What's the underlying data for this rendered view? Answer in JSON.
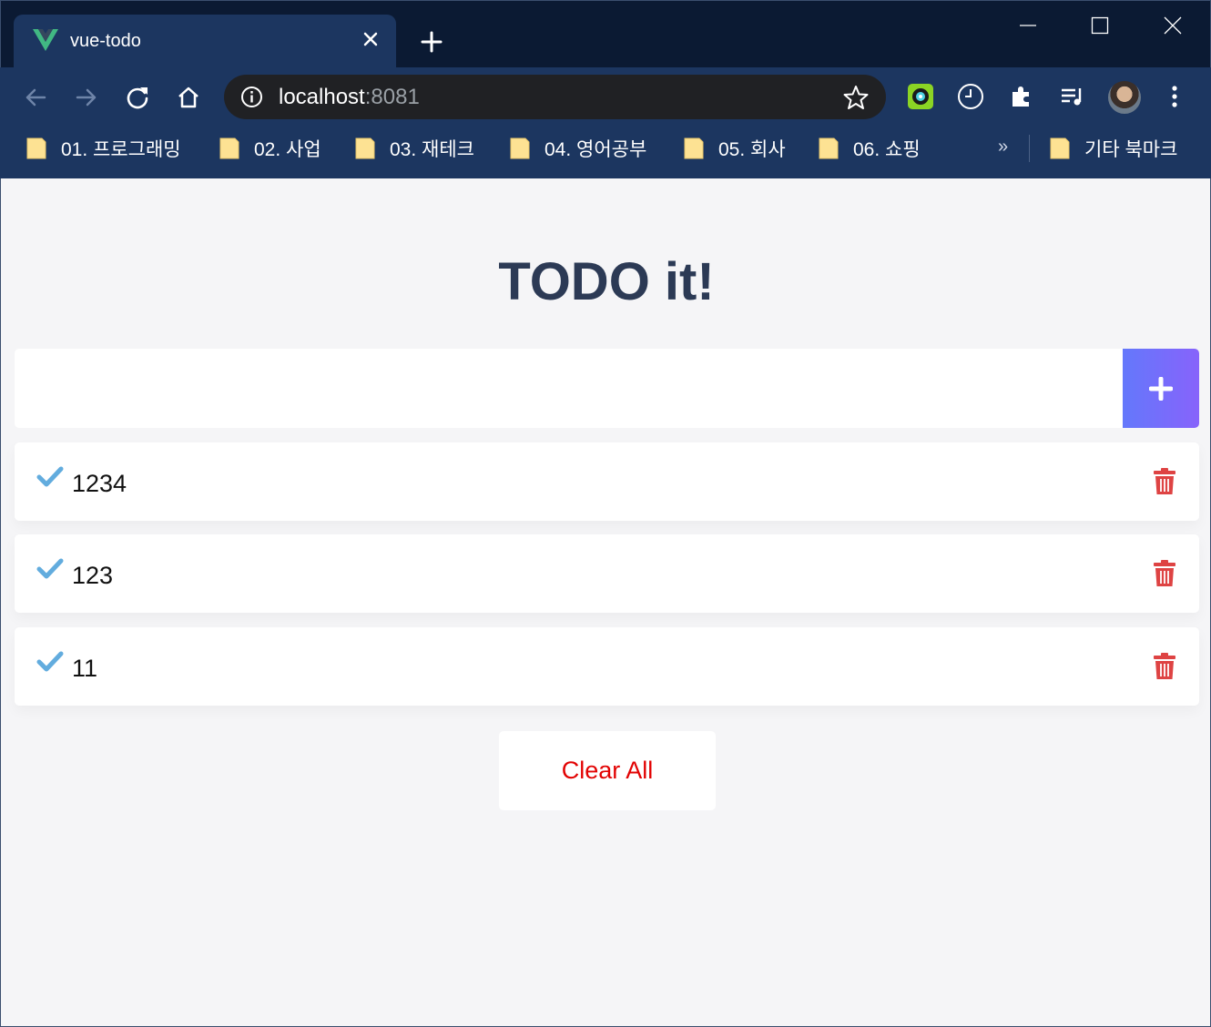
{
  "browser": {
    "tab_title": "vue-todo",
    "url_host": "localhost",
    "url_port": ":8081",
    "bookmarks": [
      {
        "label": "01. 프로그래밍"
      },
      {
        "label": "02. 사업"
      },
      {
        "label": "03. 재테크"
      },
      {
        "label": "04. 영어공부"
      },
      {
        "label": "05. 회사"
      },
      {
        "label": "06. 쇼핑"
      }
    ],
    "bookmarks_overflow": "»",
    "other_bookmarks": "기타 북마크"
  },
  "app": {
    "title": "TODO it!",
    "input_value": "",
    "todos": [
      {
        "text": "1234"
      },
      {
        "text": "123"
      },
      {
        "text": "11"
      }
    ],
    "clear_all_label": "Clear All"
  },
  "colors": {
    "accent_gradient_start": "#6478fb",
    "accent_gradient_end": "#8763fb",
    "check": "#62acde",
    "trash": "#de4343",
    "clear_all_text": "#e20303",
    "title": "#2c3a55"
  }
}
